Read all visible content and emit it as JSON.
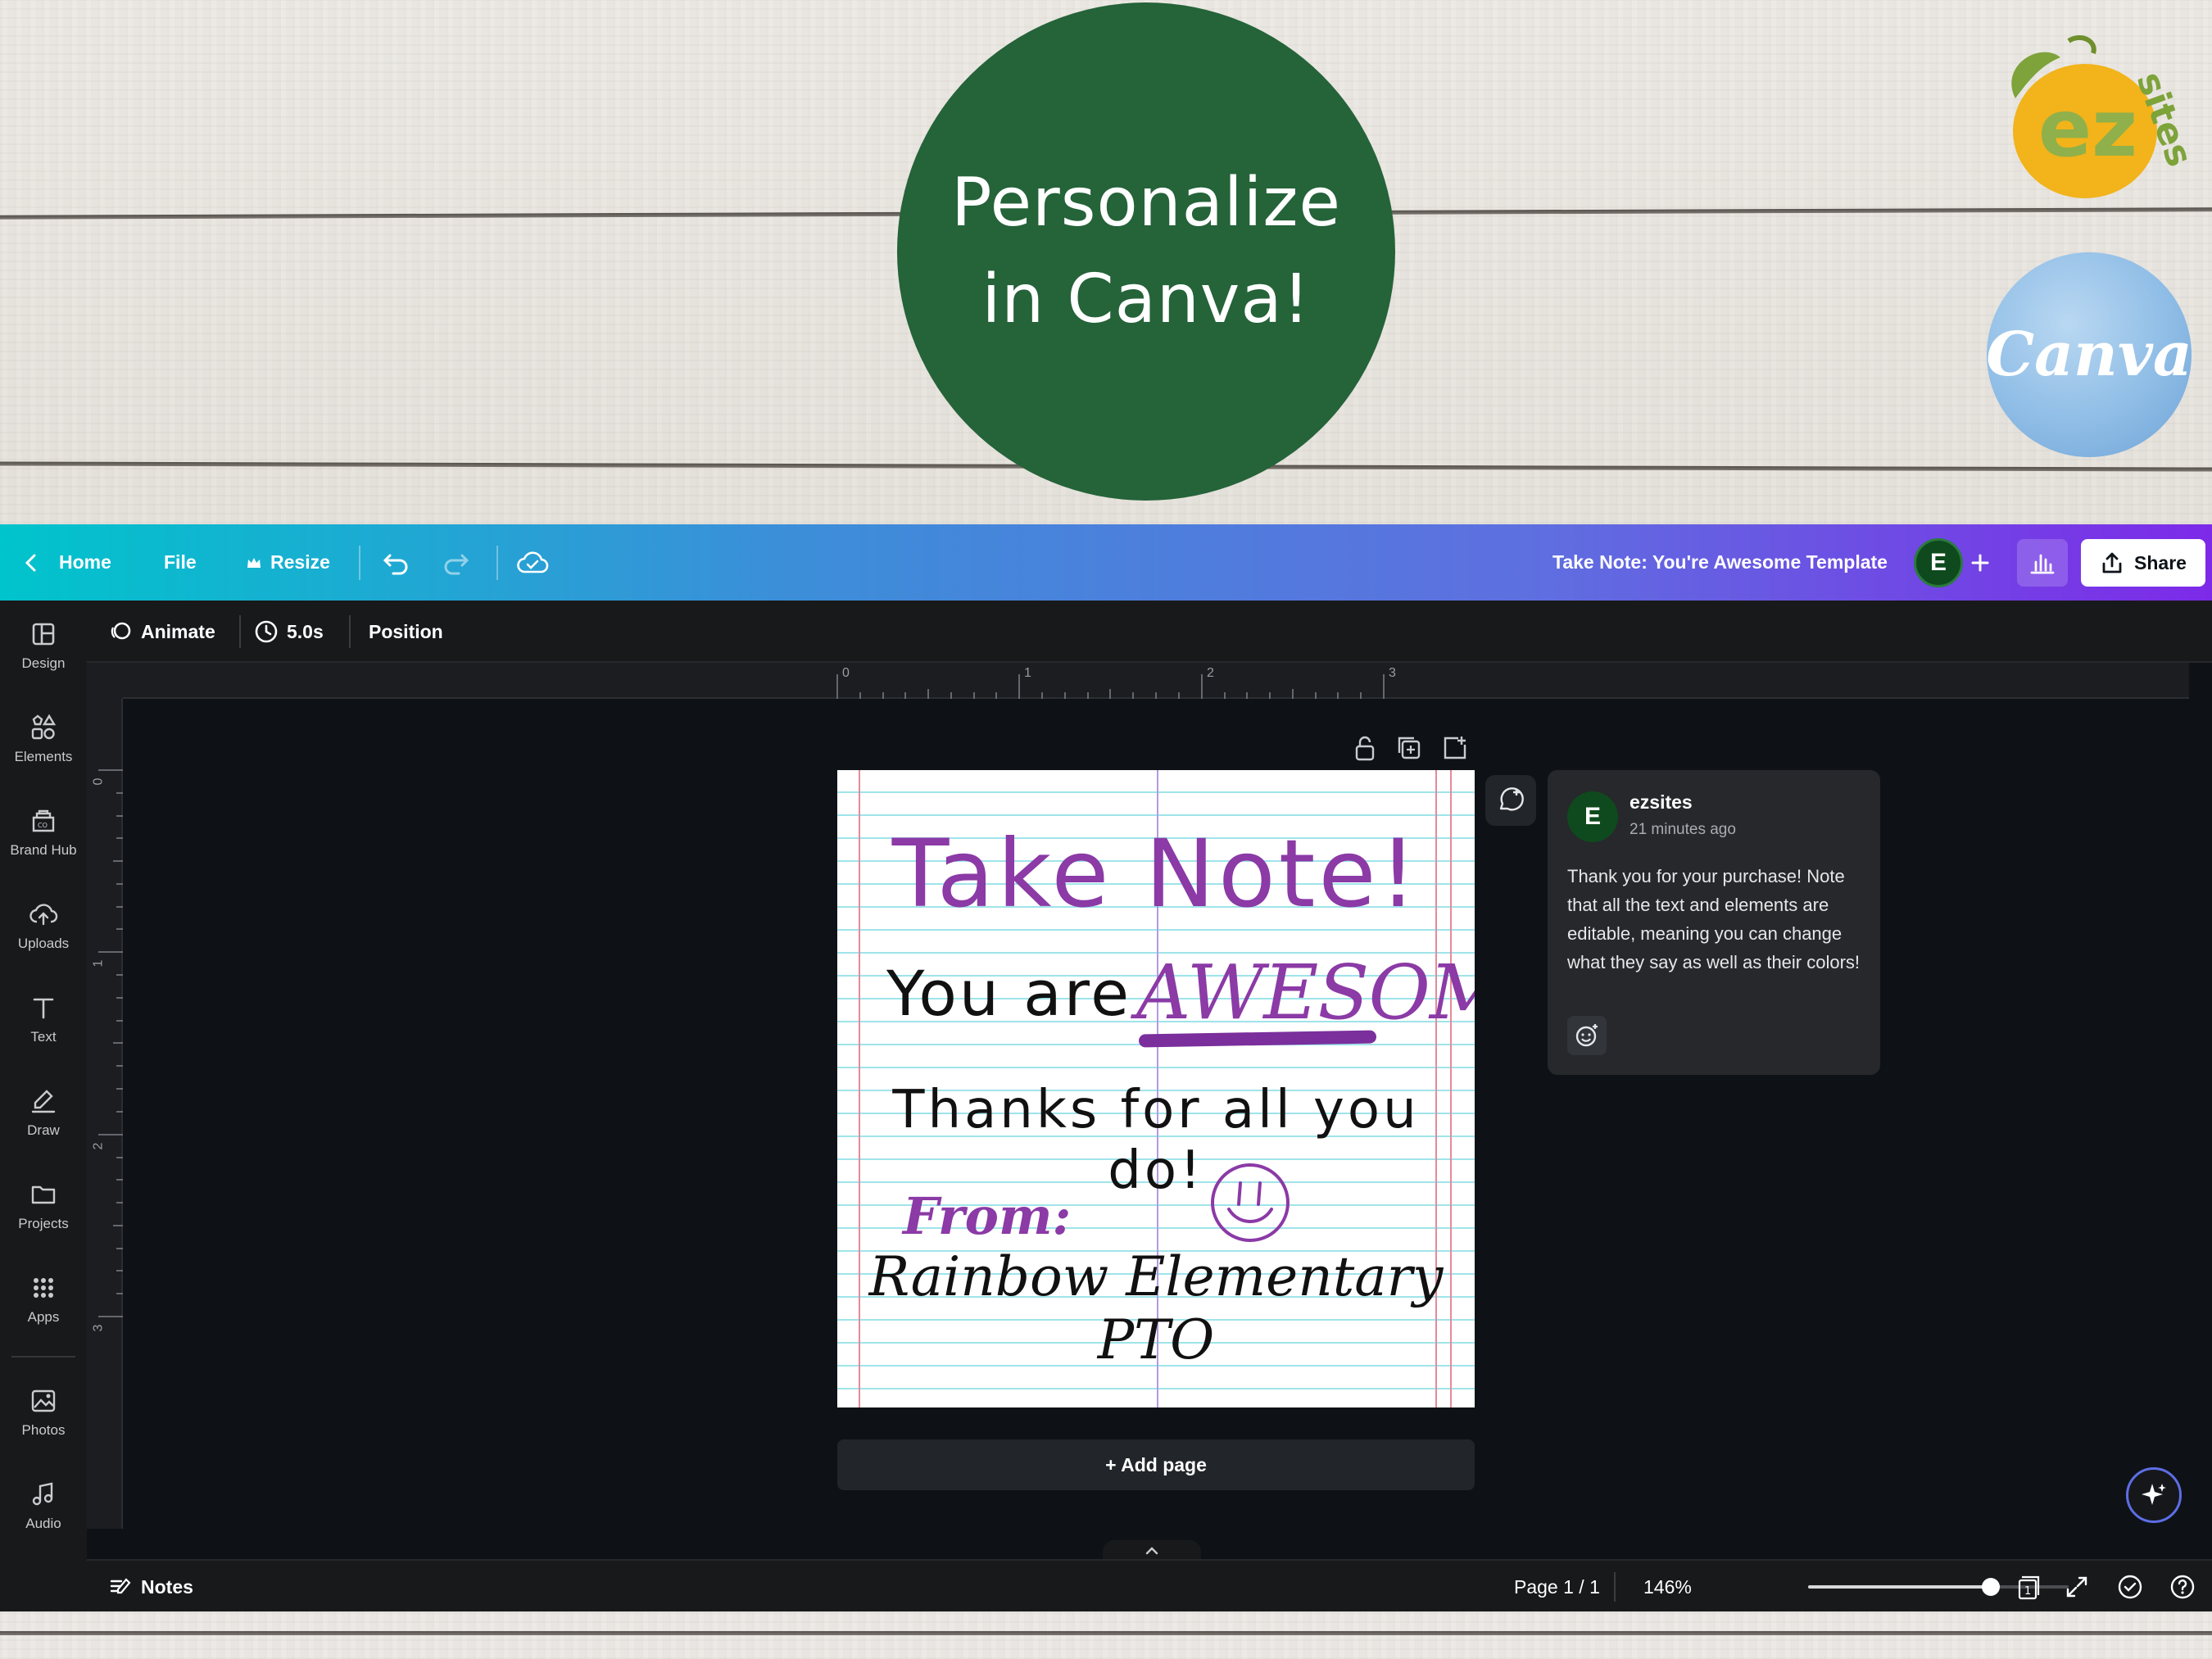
{
  "promo": {
    "line1": "Personalize",
    "line2": "in Canva!",
    "canva_logo_text": "Canva",
    "ez_logo_text": "ez sites"
  },
  "topbar": {
    "home_label": "Home",
    "file_label": "File",
    "resize_label": "Resize",
    "doc_title": "Take Note: You're Awesome Template",
    "avatar_initial": "E",
    "share_label": "Share"
  },
  "sidebar": {
    "items": [
      {
        "label": "Design",
        "icon": "layout-icon"
      },
      {
        "label": "Elements",
        "icon": "shapes-icon"
      },
      {
        "label": "Brand Hub",
        "icon": "brand-icon"
      },
      {
        "label": "Uploads",
        "icon": "cloud-upload-icon"
      },
      {
        "label": "Text",
        "icon": "text-icon"
      },
      {
        "label": "Draw",
        "icon": "pen-icon"
      },
      {
        "label": "Projects",
        "icon": "folder-icon"
      },
      {
        "label": "Apps",
        "icon": "grid-icon"
      },
      {
        "label": "Photos",
        "icon": "image-icon"
      },
      {
        "label": "Audio",
        "icon": "music-icon"
      }
    ]
  },
  "context_bar": {
    "animate_label": "Animate",
    "duration_label": "5.0s",
    "position_label": "Position"
  },
  "ruler": {
    "h_marks": [
      "0",
      "1",
      "2",
      "3"
    ],
    "v_marks": [
      "0",
      "1",
      "2",
      "3"
    ]
  },
  "design": {
    "title": "Take Note!",
    "you_are": "You are",
    "awesome": "AWESOME",
    "thanks": "Thanks for all you do!",
    "from": "From:",
    "school": "Rainbow Elementary PTO"
  },
  "add_page_label": "+ Add page",
  "comment": {
    "author_initial": "E",
    "author": "ezsites",
    "time": "21 minutes ago",
    "body": "Thank you for your purchase! Note that all the text and elements are editable, meaning you can change what they say as well as their colors!"
  },
  "bottombar": {
    "notes_label": "Notes",
    "page_indicator": "Page 1 / 1",
    "zoom_label": "146%",
    "zoom_fraction": 0.7,
    "pages_count": "1"
  },
  "colors": {
    "promo_green": "#256339",
    "design_purple": "#8b3aa6",
    "avatar_green": "#0e4a1d"
  }
}
